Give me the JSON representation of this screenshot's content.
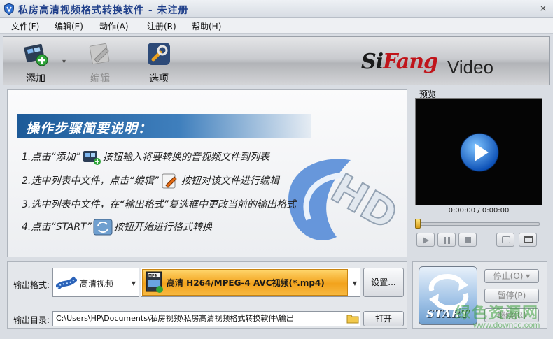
{
  "window": {
    "title": "私房高清视频格式转换软件 - 未注册",
    "min_glyph": "_",
    "close_glyph": "×"
  },
  "menu": {
    "items": [
      {
        "label": "文件(F)"
      },
      {
        "label": "编辑(E)"
      },
      {
        "label": "动作(A)"
      },
      {
        "label": "注册(R)"
      },
      {
        "label": "帮助(H)"
      }
    ]
  },
  "toolbar": {
    "add_label": "添加",
    "edit_label": "编辑",
    "options_label": "选项",
    "brand_left": "Si",
    "brand_mid": "Fang",
    "brand_right": "Video"
  },
  "guide": {
    "title": "操作步骤简要说明：",
    "steps": [
      {
        "pre": "1.点击“添加”",
        "post": "按钮输入将要转换的音视频文件到列表"
      },
      {
        "pre": "2.选中列表中文件，点击“编辑”",
        "post": "按钮对该文件进行编辑"
      },
      {
        "pre": "3.选中列表中文件，在“输出格式”复选框中更改当前的输出格式",
        "post": ""
      },
      {
        "pre": "4.点击“START”",
        "post": "按钮开始进行格式转换"
      }
    ]
  },
  "preview": {
    "label": "预览",
    "timecode": "0:00:00 / 0:00:00",
    "seek_fraction": 0.0
  },
  "output": {
    "format_label": "输出格式:",
    "format_value": "高清视频",
    "profile_value": "高清 H264/MPEG-4 AVC视频(*.mp4)",
    "settings_button": "设置...",
    "dir_label": "输出目录:",
    "dir_value": "C:\\Users\\HP\\Documents\\私房视频\\私房高清视频格式转换软件\\输出",
    "open_button": "打开"
  },
  "actions": {
    "start_label": "START",
    "stop_label": "停止(O)",
    "pause_label": "暂停(P)",
    "continue_label": "继续(R)"
  },
  "watermark": {
    "main": "绿色资源网",
    "sub": "www.downcc.com"
  },
  "colors": {
    "accent_blue": "#1f3f8a",
    "profile_orange": "#f2a21c",
    "brand_red": "#c0141a"
  }
}
